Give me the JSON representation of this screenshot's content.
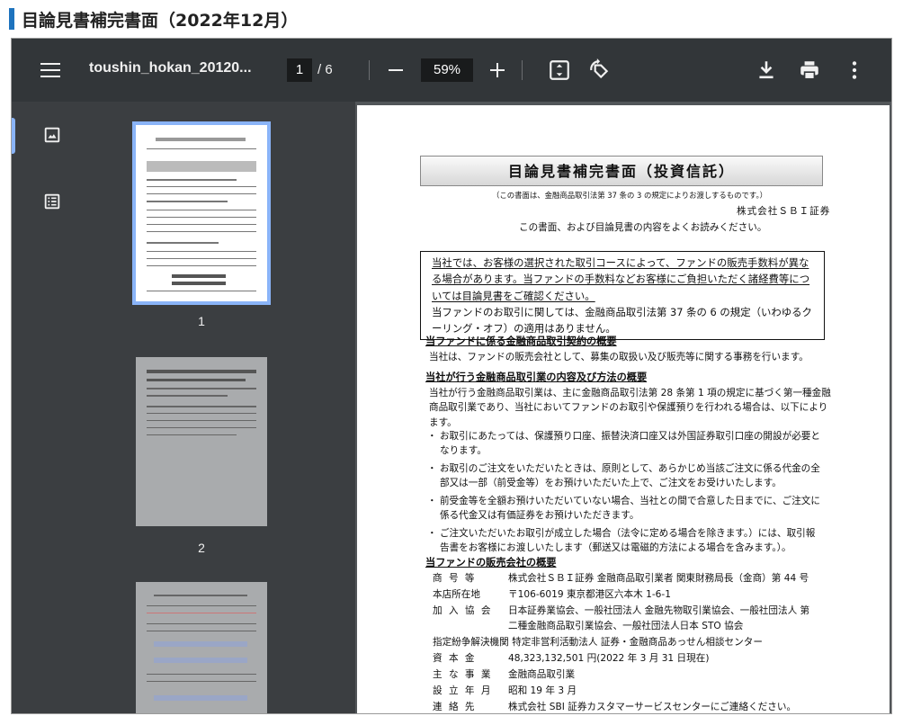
{
  "page": {
    "heading": "目論見書補完書面（2022年12月）",
    "accent": "#1e73be"
  },
  "toolbar": {
    "file_name": "toushin_hokan_20120...",
    "current_page": "1",
    "total_pages": "/ 6",
    "zoom": "59%",
    "icons": [
      "menu-icon",
      "zoom-out-icon",
      "zoom-in-icon",
      "fit-page-icon",
      "rotate-icon",
      "download-icon",
      "print-icon",
      "more-icon"
    ]
  },
  "sidebar": {
    "thumbnails": [
      {
        "label": "1"
      },
      {
        "label": "2"
      }
    ],
    "icons": [
      "thumbnail-view-icon",
      "outline-view-icon"
    ]
  },
  "doc": {
    "title": "目論見書補完書面（投資信託）",
    "subtitle": "（この書面は、金融商品取引法第 37 条の 3 の規定によりお渡しするものです。）",
    "company": "株式会社ＳＢＩ証券",
    "intro": "この書面、および目論見書の内容をよくお読みください。",
    "notice_underlined": "当社では、お客様の選択された取引コースによって、ファンドの販売手数料が異なる場合があります。当ファンドの手数料などお客様にご負担いただく諸経費等については目論見書をご確認ください。",
    "notice_plain": "当ファンドのお取引に関しては、金融商品取引法第 37 条の 6 の規定（いわゆるクーリング・オフ）の適用はありません。",
    "sec1_title": "当ファンドに係る金融商品取引契約の概要",
    "sec1_body": "当社は、ファンドの販売会社として、募集の取扱い及び販売等に関する事務を行います。",
    "sec2_title": "当社が行う金融商品取引業の内容及び方法の概要",
    "sec2_body": "当社が行う金融商品取引業は、主に金融商品取引法第 28 条第 1 項の規定に基づく第一種金融商品取引業であり、当社においてファンドのお取引や保護預りを行われる場合は、以下によります。",
    "bullets": [
      "お取引にあたっては、保護預り口座、振替決済口座又は外国証券取引口座の開設が必要となります。",
      "お取引のご注文をいただいたときは、原則として、あらかじめ当該ご注文に係る代金の全部又は一部（前受金等）をお預けいただいた上で、ご注文をお受けいたします。",
      "前受金等を全額お預けいただいていない場合、当社との間で合意した日までに、ご注文に係る代金又は有価証券をお預けいただきます。",
      "ご注文いただいたお取引が成立した場合（法令に定める場合を除きます。）には、取引報告書をお客様にお渡しいたします（郵送又は電磁的方法による場合を含みます。）。"
    ],
    "sec3_title": "当ファンドの販売会社の概要",
    "company_table": [
      {
        "key": "商 号 等",
        "value": "株式会社ＳＢＩ証券 金融商品取引業者 関東財務局長（金商）第 44 号"
      },
      {
        "key": "本店所在地",
        "value": "〒106-6019 東京都港区六本木 1-6-1"
      },
      {
        "key": "加 入 協 会",
        "value": "日本証券業協会、一般社団法人 金融先物取引業協会、一般社団法人 第二種金融商品取引業協会、一般社団法人日本 STO 協会"
      },
      {
        "key": "指定紛争解決機関",
        "value": "特定非営利活動法人 証券・金融商品あっせん相談センター"
      },
      {
        "key": "資 本 金",
        "value": "48,323,132,501 円(2022 年 3 月 31 日現在)"
      },
      {
        "key": "主 な 事 業",
        "value": "金融商品取引業"
      },
      {
        "key": "設 立 年 月",
        "value": "昭和 19 年 3 月"
      },
      {
        "key": "連 絡 先",
        "value": "株式会社 SBI 証券カスタマーサービスセンターにご連絡ください。"
      }
    ]
  }
}
